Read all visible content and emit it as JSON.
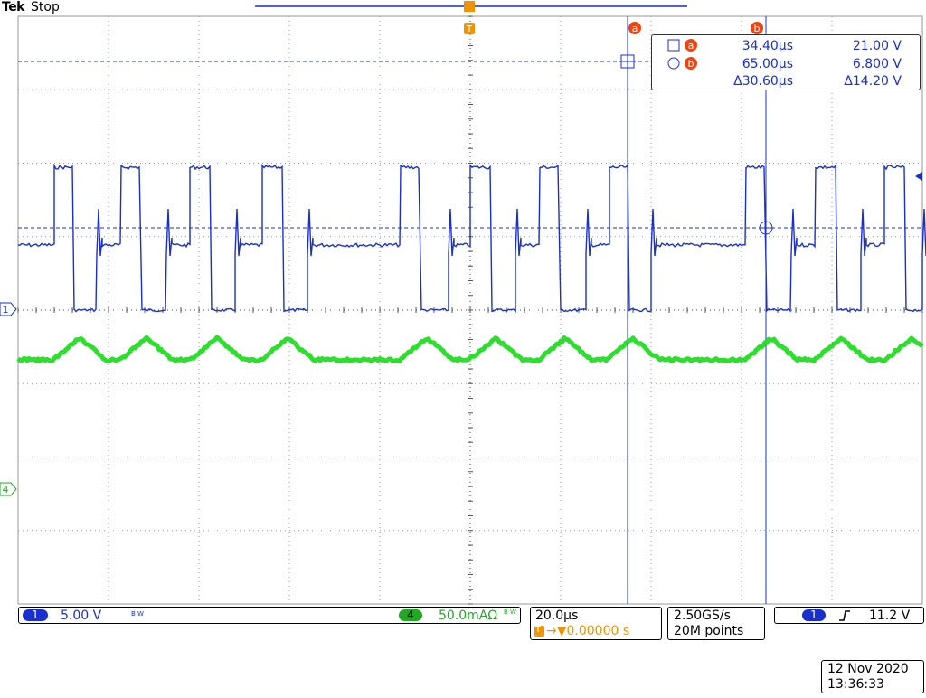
{
  "header": {
    "brand": "Tek",
    "acquisition_state": "Stop",
    "trigger_marker": "T"
  },
  "cursors": {
    "a": {
      "label": "a",
      "x_us": 34.4,
      "y_V": 21.0,
      "time_text": "34.40µs",
      "volt_text": "21.00 V"
    },
    "b": {
      "label": "b",
      "x_us": 65.0,
      "y_V": 6.8,
      "time_text": "65.00µs",
      "volt_text": "6.800 V"
    },
    "delta": {
      "time_text": "Δ30.60µs",
      "volt_text": "Δ14.20 V"
    }
  },
  "channels": {
    "ch1": {
      "number": "1",
      "scale_text": "5.00 V",
      "bw_text": "B W",
      "color": "#1a2fd0"
    },
    "ch4": {
      "number": "4",
      "scale_text": "50.0mAΩ",
      "bw_text": "B W",
      "color": "#22dd22"
    }
  },
  "timebase": {
    "scale_text": "20.0µs",
    "trigger_position_text": "→▼0.00000 s",
    "trigger_icon": "T"
  },
  "acquisition": {
    "sample_rate_text": "2.50GS/s",
    "record_length_text": "20M points"
  },
  "trigger": {
    "source": "1",
    "slope_icon": "rising-edge-icon",
    "level_text": "11.2 V"
  },
  "datetime": {
    "date": "12 Nov 2020",
    "time": "13:36:33"
  },
  "colors": {
    "ch1": "#1a2fd0",
    "ch4": "#22dd22",
    "cursor_badge": "#ee4411",
    "trigger": "#f09400",
    "grid": "#888888"
  }
}
